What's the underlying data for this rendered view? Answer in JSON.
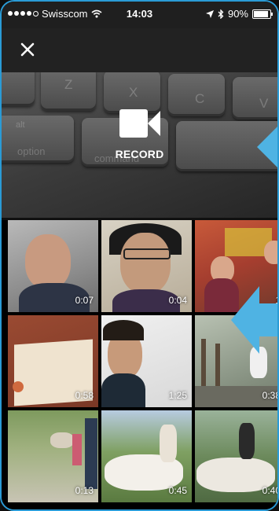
{
  "status_bar": {
    "carrier": "Swisscom",
    "time": "14:03",
    "battery": "90%",
    "battery_level": 0.9
  },
  "top_bar": {
    "close_icon": "close-icon"
  },
  "preview": {
    "keys": [
      "Z",
      "X",
      "C",
      "V",
      "alt",
      "option",
      "command"
    ],
    "record_label": "RECORD",
    "record_icon": "video-camera-icon"
  },
  "gallery": {
    "videos": [
      {
        "duration": "0:07"
      },
      {
        "duration": "0:04"
      },
      {
        "duration": "1"
      },
      {
        "duration": "0:58"
      },
      {
        "duration": "1:25"
      },
      {
        "duration": "0:38"
      },
      {
        "duration": "0:13"
      },
      {
        "duration": "0:45"
      },
      {
        "duration": "0:40"
      }
    ]
  },
  "colors": {
    "accent": "#2a9bd6",
    "arrow": "#4fb3e3"
  }
}
